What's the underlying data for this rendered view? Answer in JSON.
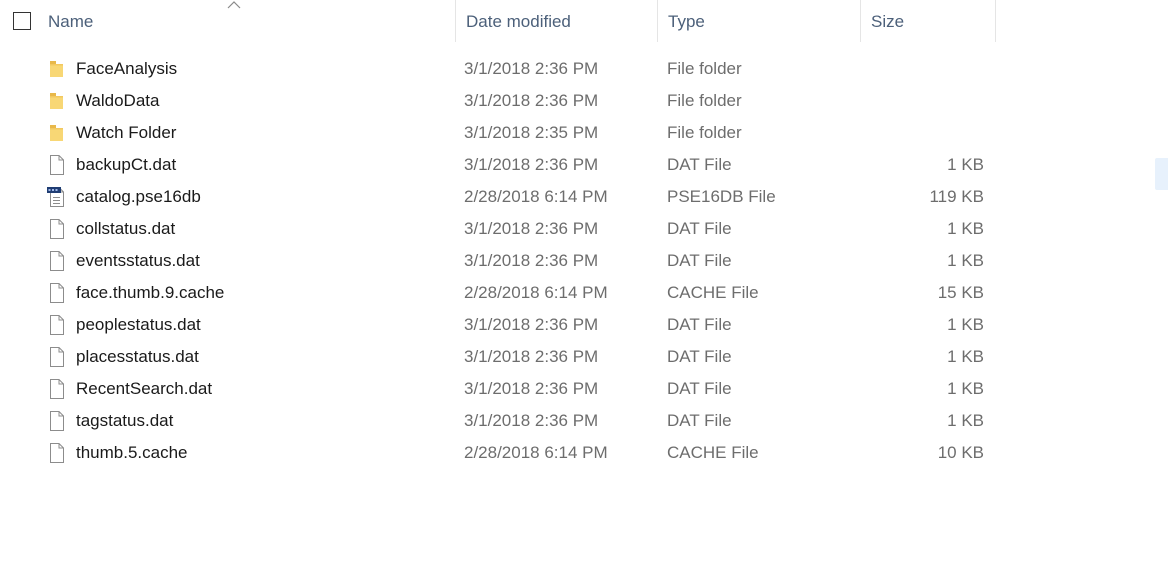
{
  "header": {
    "name": "Name",
    "date_modified": "Date modified",
    "type": "Type",
    "size": "Size"
  },
  "colors": {
    "header_text": "#4c607a",
    "name_text": "#1a1a1a",
    "meta_text": "#6d6d6d",
    "folder_icon": "#f8d775",
    "folder_icon_dark": "#e8b84a"
  },
  "files": [
    {
      "name": "FaceAnalysis",
      "date": "3/1/2018 2:36 PM",
      "type": "File folder",
      "size": "",
      "icon": "folder-icon"
    },
    {
      "name": "WaldoData",
      "date": "3/1/2018 2:36 PM",
      "type": "File folder",
      "size": "",
      "icon": "folder-icon"
    },
    {
      "name": "Watch Folder",
      "date": "3/1/2018 2:35 PM",
      "type": "File folder",
      "size": "",
      "icon": "folder-icon"
    },
    {
      "name": "backupCt.dat",
      "date": "3/1/2018 2:36 PM",
      "type": "DAT File",
      "size": "1 KB",
      "icon": "file-icon"
    },
    {
      "name": "catalog.pse16db",
      "date": "2/28/2018 6:14 PM",
      "type": "PSE16DB File",
      "size": "119 KB",
      "icon": "database-file-icon"
    },
    {
      "name": "collstatus.dat",
      "date": "3/1/2018 2:36 PM",
      "type": "DAT File",
      "size": "1 KB",
      "icon": "file-icon"
    },
    {
      "name": "eventsstatus.dat",
      "date": "3/1/2018 2:36 PM",
      "type": "DAT File",
      "size": "1 KB",
      "icon": "file-icon"
    },
    {
      "name": "face.thumb.9.cache",
      "date": "2/28/2018 6:14 PM",
      "type": "CACHE File",
      "size": "15 KB",
      "icon": "file-icon"
    },
    {
      "name": "peoplestatus.dat",
      "date": "3/1/2018 2:36 PM",
      "type": "DAT File",
      "size": "1 KB",
      "icon": "file-icon"
    },
    {
      "name": "placesstatus.dat",
      "date": "3/1/2018 2:36 PM",
      "type": "DAT File",
      "size": "1 KB",
      "icon": "file-icon"
    },
    {
      "name": "RecentSearch.dat",
      "date": "3/1/2018 2:36 PM",
      "type": "DAT File",
      "size": "1 KB",
      "icon": "file-icon"
    },
    {
      "name": "tagstatus.dat",
      "date": "3/1/2018 2:36 PM",
      "type": "DAT File",
      "size": "1 KB",
      "icon": "file-icon"
    },
    {
      "name": "thumb.5.cache",
      "date": "2/28/2018 6:14 PM",
      "type": "CACHE File",
      "size": "10 KB",
      "icon": "file-icon"
    }
  ]
}
